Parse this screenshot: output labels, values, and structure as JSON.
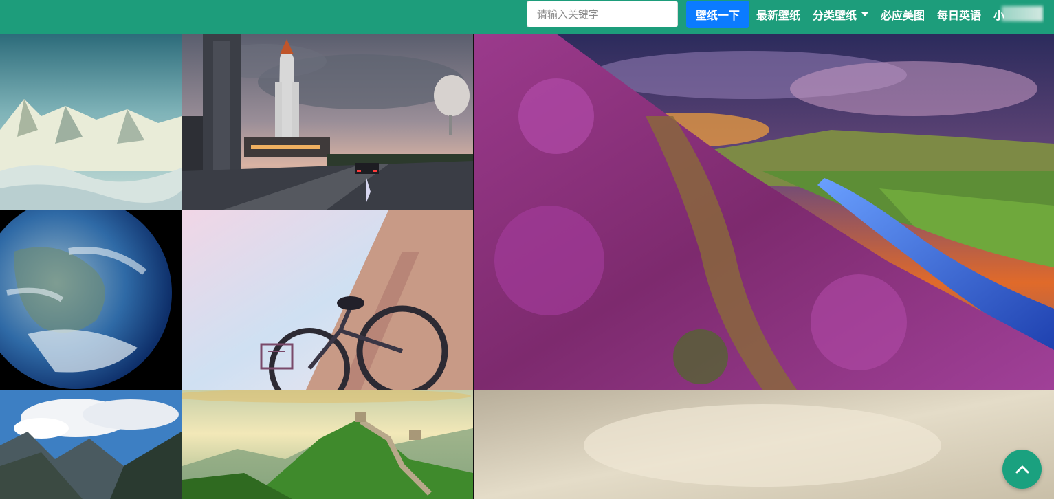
{
  "header": {
    "search": {
      "placeholder": "请输入关键字",
      "value": ""
    },
    "search_button": "壁纸一下",
    "nav": {
      "latest": "最新壁纸",
      "categories": "分类壁纸",
      "bing": "必应美图",
      "daily_english": "每日英语",
      "user": "小"
    }
  },
  "gallery": {
    "tiles": [
      {
        "subject": "snowy-mountain-range"
      },
      {
        "subject": "space-shuttle-launch-road"
      },
      {
        "subject": "heather-hillside-river-sunset"
      },
      {
        "subject": "earth-from-space"
      },
      {
        "subject": "bicycle-against-wall"
      },
      {
        "subject": "mountain-valley-clouds"
      },
      {
        "subject": "great-wall-green-hills"
      },
      {
        "subject": "beige-blurred-landscape"
      }
    ]
  },
  "icons": {
    "back_to_top": "chevron-up-icon",
    "dropdown": "caret-down-icon"
  },
  "colors": {
    "navbar": "#1d9d7b",
    "search_button": "#0b7bff",
    "back_to_top": "#1aa17f"
  }
}
